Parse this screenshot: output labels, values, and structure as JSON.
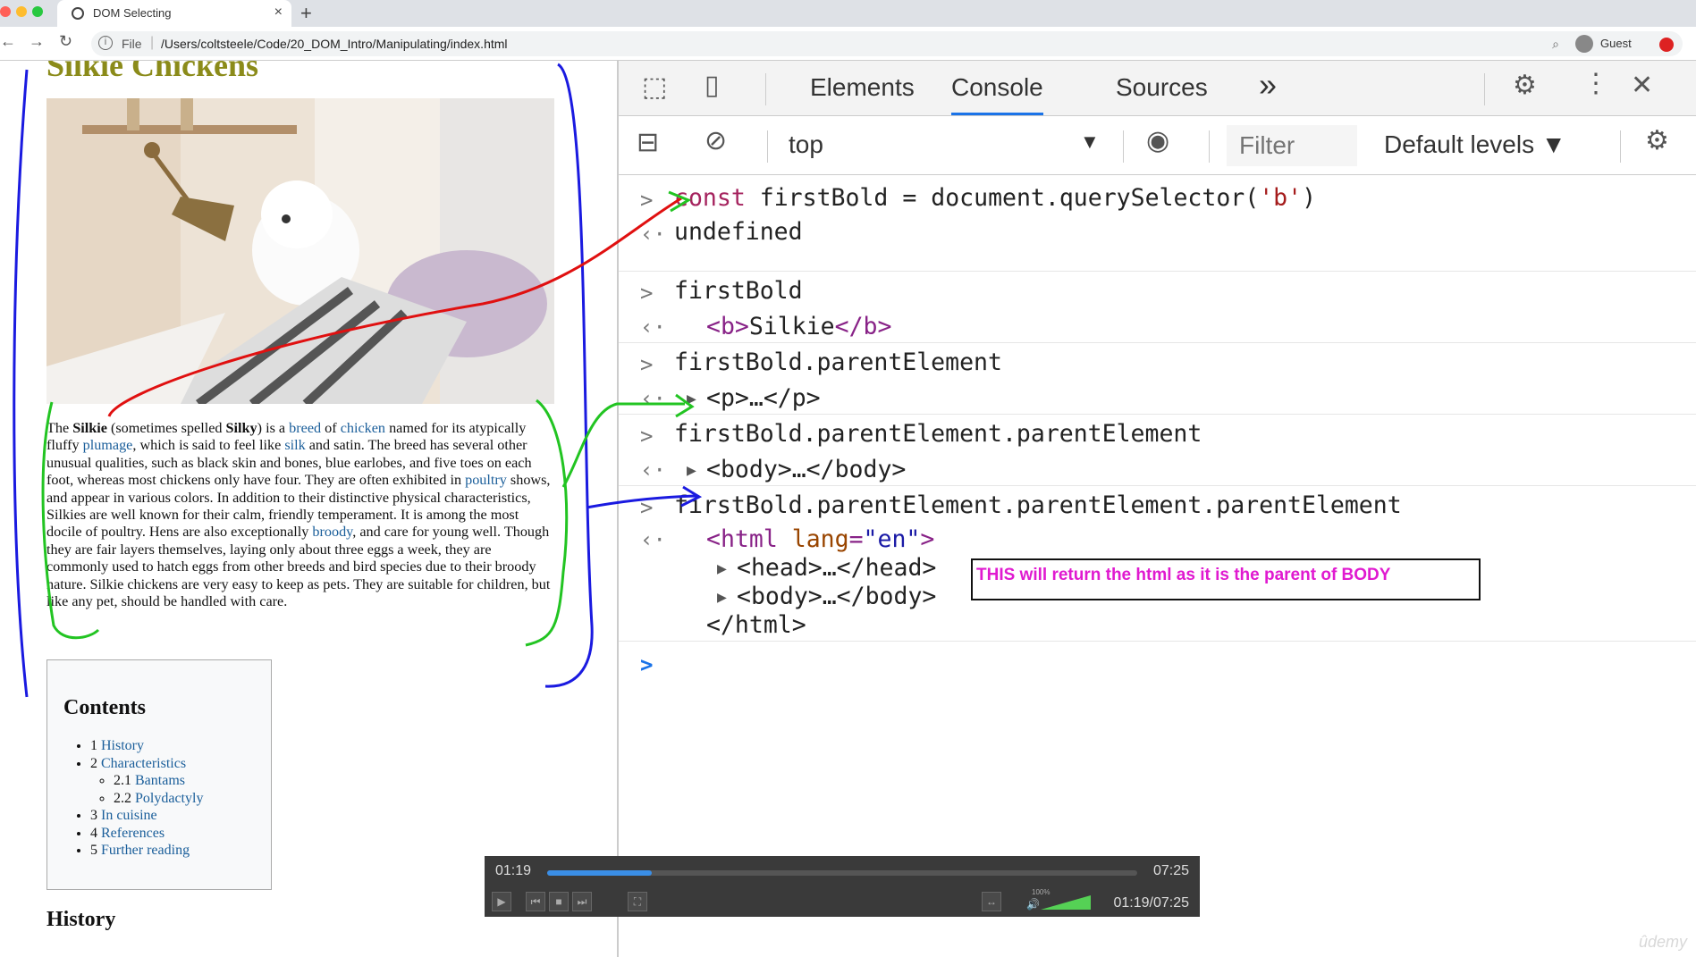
{
  "browser": {
    "tab_title": "DOM Selecting",
    "tab_close": "×",
    "new_tab": "+",
    "url_scheme": "File",
    "url": "/Users/coltsteele/Code/20_DOM_Intro/Manipulating/index.html",
    "profile_label": "Guest"
  },
  "page": {
    "title": "Silkie Chickens",
    "paragraph": [
      {
        "t": "The ",
        "k": "text"
      },
      {
        "t": "Silkie",
        "k": "bold"
      },
      {
        "t": " (sometimes spelled ",
        "k": "text"
      },
      {
        "t": "Silky",
        "k": "bold"
      },
      {
        "t": ") is a ",
        "k": "text"
      },
      {
        "t": "breed",
        "k": "link"
      },
      {
        "t": " of ",
        "k": "text"
      },
      {
        "t": "chicken",
        "k": "link"
      },
      {
        "t": " named for its atypically fluffy ",
        "k": "text"
      },
      {
        "t": "plumage",
        "k": "link"
      },
      {
        "t": ", which is said to feel like ",
        "k": "text"
      },
      {
        "t": "silk",
        "k": "link"
      },
      {
        "t": " and satin. The breed has several other unusual qualities, such as black skin and bones, blue earlobes, and five toes on each foot, whereas most chickens only have four. They are often exhibited in ",
        "k": "text"
      },
      {
        "t": "poultry",
        "k": "link"
      },
      {
        "t": " shows, and appear in various colors. In addition to their distinctive physical characteristics, Silkies are well known for their calm, friendly temperament. It is among the most docile of poultry. Hens are also exceptionally ",
        "k": "text"
      },
      {
        "t": "broody",
        "k": "link"
      },
      {
        "t": ", and care for young well. Though they are fair layers themselves, laying only about three eggs a week, they are commonly used to hatch eggs from other breeds and bird species due to their broody nature. Silkie chickens are very easy to keep as pets. They are suitable for children, but like any pet, should be handled with care.",
        "k": "text"
      }
    ],
    "toc_title": "Contents",
    "toc": [
      {
        "num": "1",
        "label": "History"
      },
      {
        "num": "2",
        "label": "Characteristics",
        "children": [
          {
            "num": "2.1",
            "label": "Bantams"
          },
          {
            "num": "2.2",
            "label": "Polydactyly"
          }
        ]
      },
      {
        "num": "3",
        "label": "In cuisine"
      },
      {
        "num": "4",
        "label": "References"
      },
      {
        "num": "5",
        "label": "Further reading"
      }
    ],
    "history_heading": "History"
  },
  "devtools": {
    "tabs": [
      "Elements",
      "Console",
      "Sources"
    ],
    "active_tab": "Console",
    "more_tabs": "»",
    "context": "top",
    "filter_placeholder": "Filter",
    "levels": "Default levels",
    "console": {
      "line1_var": "firstBold",
      "line1_expr": "document.querySelector(",
      "line1_arg": "'b'",
      "line1_close": ")",
      "line1_kw": "const",
      "line1_eq": "=",
      "r1": "undefined",
      "line2": "firstBold",
      "r2_open": "<b>",
      "r2_text": "Silkie",
      "r2_close": "</b>",
      "line3": "firstBold.parentElement",
      "r3": "<p>…</p>",
      "line4": "firstBold.parentElement.parentElement",
      "r4": "<body>…</body>",
      "line5": "firstBold.parentElement.parentElement.parentElement",
      "r5_open": "<html",
      "r5_attr": "lang",
      "r5_val": "\"en\"",
      "r5_gt": ">",
      "r5_head": "<head>…</head>",
      "r5_body": "<body>…</body>",
      "r5_close": "</html>"
    },
    "annotation": "THIS will return the html as it is the parent of BODY"
  },
  "player": {
    "elapsed": "01:19",
    "duration": "07:25",
    "progress": 0.177,
    "volume_label": "100%",
    "time_combined": "01:19/07:25"
  },
  "watermark": "ûdemy"
}
